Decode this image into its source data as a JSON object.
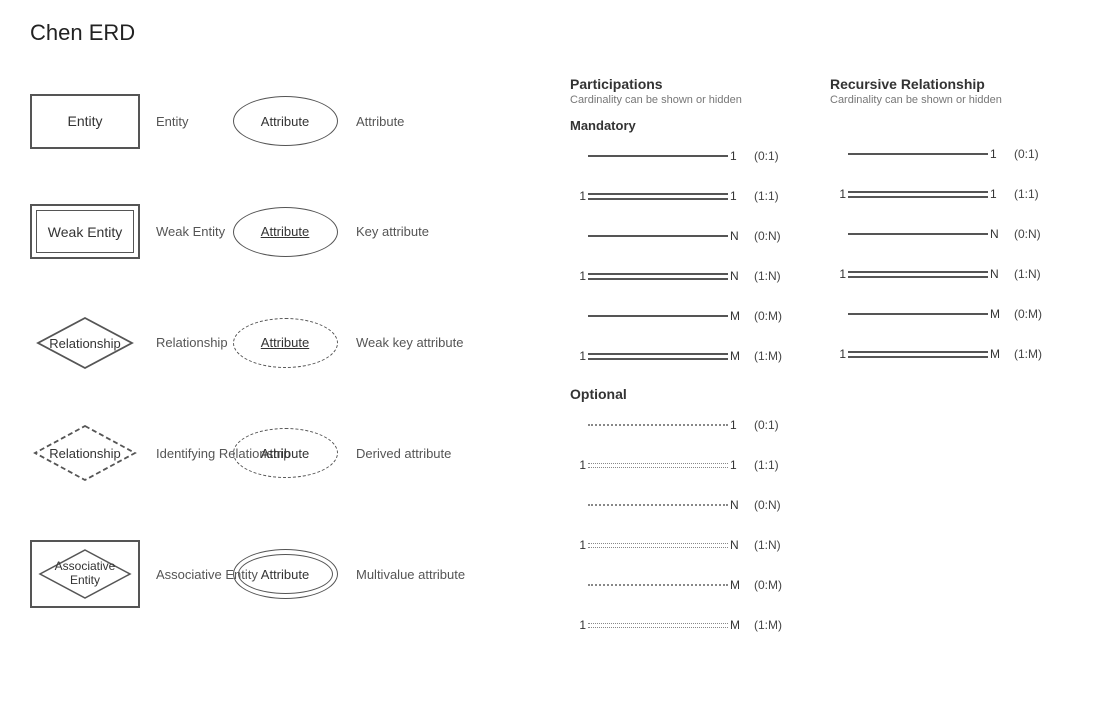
{
  "title": "Chen ERD",
  "shapes": {
    "entity": {
      "label": "Entity",
      "name": "Entity"
    },
    "weak_entity": {
      "label": "Weak Entity",
      "name": "Weak Entity"
    },
    "relationship": {
      "label": "Relationship",
      "name": "Relationship"
    },
    "identifying_relationship": {
      "label": "Relationship",
      "name": "Identifying Relationship"
    },
    "associative_entity": {
      "label": "Associative\nEntity",
      "name": "Associative Entity"
    },
    "attribute": {
      "label": "Attribute",
      "name": "Attribute"
    },
    "key_attribute": {
      "label": "Attribute",
      "name": "Key attribute"
    },
    "weak_key_attribute": {
      "label": "Attribute",
      "name": "Weak key attribute"
    },
    "derived_attribute": {
      "label": "Attribute",
      "name": "Derived attribute"
    },
    "multivalue_attribute": {
      "label": "Attribute",
      "name": "Multivalue attribute"
    }
  },
  "participations": {
    "title": "Participations",
    "subtitle": "Cardinality can be shown or hidden",
    "mandatory_title": "Mandatory",
    "optional_title": "Optional",
    "mandatory_items": [
      {
        "left": "",
        "right": "1",
        "label": "(0:1)",
        "line_type": "single"
      },
      {
        "left": "1",
        "right": "1",
        "label": "(1:1)",
        "line_type": "double"
      },
      {
        "left": "",
        "right": "N",
        "label": "(0:N)",
        "line_type": "single"
      },
      {
        "left": "1",
        "right": "N",
        "label": "(1:N)",
        "line_type": "double"
      },
      {
        "left": "",
        "right": "M",
        "label": "(0:M)",
        "line_type": "single"
      },
      {
        "left": "1",
        "right": "M",
        "label": "(1:M)",
        "line_type": "double"
      }
    ],
    "optional_items": [
      {
        "left": "",
        "right": "1",
        "label": "(0:1)",
        "line_type": "dashed_single"
      },
      {
        "left": "1",
        "right": "1",
        "label": "(1:1)",
        "line_type": "dashed_double"
      },
      {
        "left": "",
        "right": "N",
        "label": "(0:N)",
        "line_type": "dashed_single"
      },
      {
        "left": "1",
        "right": "N",
        "label": "(1:N)",
        "line_type": "dashed_double"
      },
      {
        "left": "",
        "right": "M",
        "label": "(0:M)",
        "line_type": "dashed_single"
      },
      {
        "left": "1",
        "right": "M",
        "label": "(1:M)",
        "line_type": "dashed_double"
      }
    ]
  },
  "recursive": {
    "title": "Recursive Relationship",
    "subtitle": "Cardinality can be shown or hidden",
    "items": [
      {
        "left": "",
        "right": "1",
        "label": "(0:1)",
        "line_type": "single"
      },
      {
        "left": "1",
        "right": "1",
        "label": "(1:1)",
        "line_type": "double"
      },
      {
        "left": "",
        "right": "N",
        "label": "(0:N)",
        "line_type": "single"
      },
      {
        "left": "1",
        "right": "N",
        "label": "(1:N)",
        "line_type": "double"
      },
      {
        "left": "",
        "right": "M",
        "label": "(0:M)",
        "line_type": "single"
      },
      {
        "left": "1",
        "right": "M",
        "label": "(1:M)",
        "line_type": "double"
      }
    ]
  }
}
